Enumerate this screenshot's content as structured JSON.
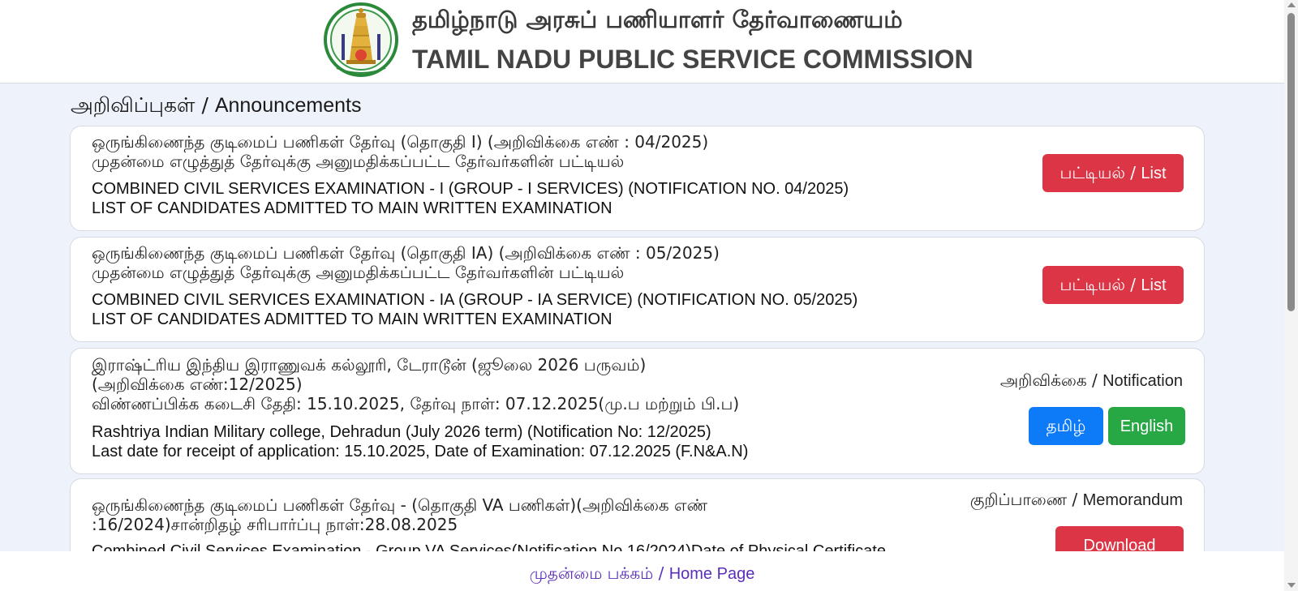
{
  "header": {
    "title_ta": "தமிழ்நாடு அரசுப் பணியாளர் தேர்வாணையம்",
    "title_en": "TAMIL NADU PUBLIC SERVICE COMMISSION"
  },
  "section": {
    "heading_ta": "அறிவிப்புகள் / ",
    "heading_en": "Announcements"
  },
  "cards": [
    {
      "ta_line1": "ஒருங்கிணைந்த குடிமைப் பணிகள் தேர்வு (தொகுதி I) (அறிவிக்கை எண் : 04/2025)",
      "ta_line2": "முதன்மை எழுத்துத் தேர்வுக்கு அனுமதிக்கப்பட்ட தேர்வர்களின் பட்டியல்",
      "en_line1": "COMBINED CIVIL SERVICES EXAMINATION - I (GROUP - I SERVICES) (NOTIFICATION NO. 04/2025)",
      "en_line2": "LIST OF CANDIDATES ADMITTED TO MAIN WRITTEN EXAMINATION",
      "button_ta": "பட்டியல் / ",
      "button_en": "List"
    },
    {
      "ta_line1": "ஒருங்கிணைந்த குடிமைப் பணிகள் தேர்வு (தொகுதி IA) (அறிவிக்கை எண் : 05/2025)",
      "ta_line2": "முதன்மை எழுத்துத் தேர்வுக்கு அனுமதிக்கப்பட்ட தேர்வர்களின் பட்டியல்",
      "en_line1": "COMBINED CIVIL SERVICES EXAMINATION - IA (GROUP - IA SERVICE) (NOTIFICATION NO. 05/2025)",
      "en_line2": "LIST OF CANDIDATES ADMITTED TO MAIN WRITTEN EXAMINATION",
      "button_ta": "பட்டியல் / ",
      "button_en": "List"
    },
    {
      "ta_line1": "இராஷ்ட்ரிய இந்திய இராணுவக் கல்லூரி, டேராடூன் (ஜூலை 2026 பருவம்)",
      "ta_line2": "(அறிவிக்கை எண்:12/2025)",
      "ta_line3": "விண்ணப்பிக்க கடைசி தேதி: 15.10.2025, தேர்வு நாள்: 07.12.2025(மு.ப மற்றும் பி.ப)",
      "en_line1": "Rashtriya Indian Military college, Dehradun (July 2026 term) (Notification No: 12/2025)",
      "en_line2": "Last date for receipt of application: 15.10.2025, Date of Examination: 07.12.2025 (F.N&A.N)",
      "label_ta": "அறிவிக்கை / ",
      "label_en": "Notification",
      "button_tamil": "தமிழ்",
      "button_english": "English"
    },
    {
      "ta_line1": "ஒருங்கிணைந்த குடிமைப் பணிகள் தேர்வு - (தொகுதி VA பணிகள்)(அறிவிக்கை எண்",
      "ta_line2": ":16/2024)சான்றிதழ் சரிபார்ப்பு நாள்:28.08.2025",
      "en_line1": "Combined Civil Services Examination - Group VA Services(Notification No.16/2024)Date of Physical Certificate",
      "label_ta": "குறிப்பாணை / ",
      "label_en": "Memorandum",
      "button": "Download"
    }
  ],
  "footer": {
    "home_ta": "முதன்மை பக்கம் / ",
    "home_en": "Home Page"
  },
  "colors": {
    "red": "#dc3545",
    "blue": "#0d7bf7",
    "green": "#28a745",
    "link": "#5a2eb8"
  }
}
